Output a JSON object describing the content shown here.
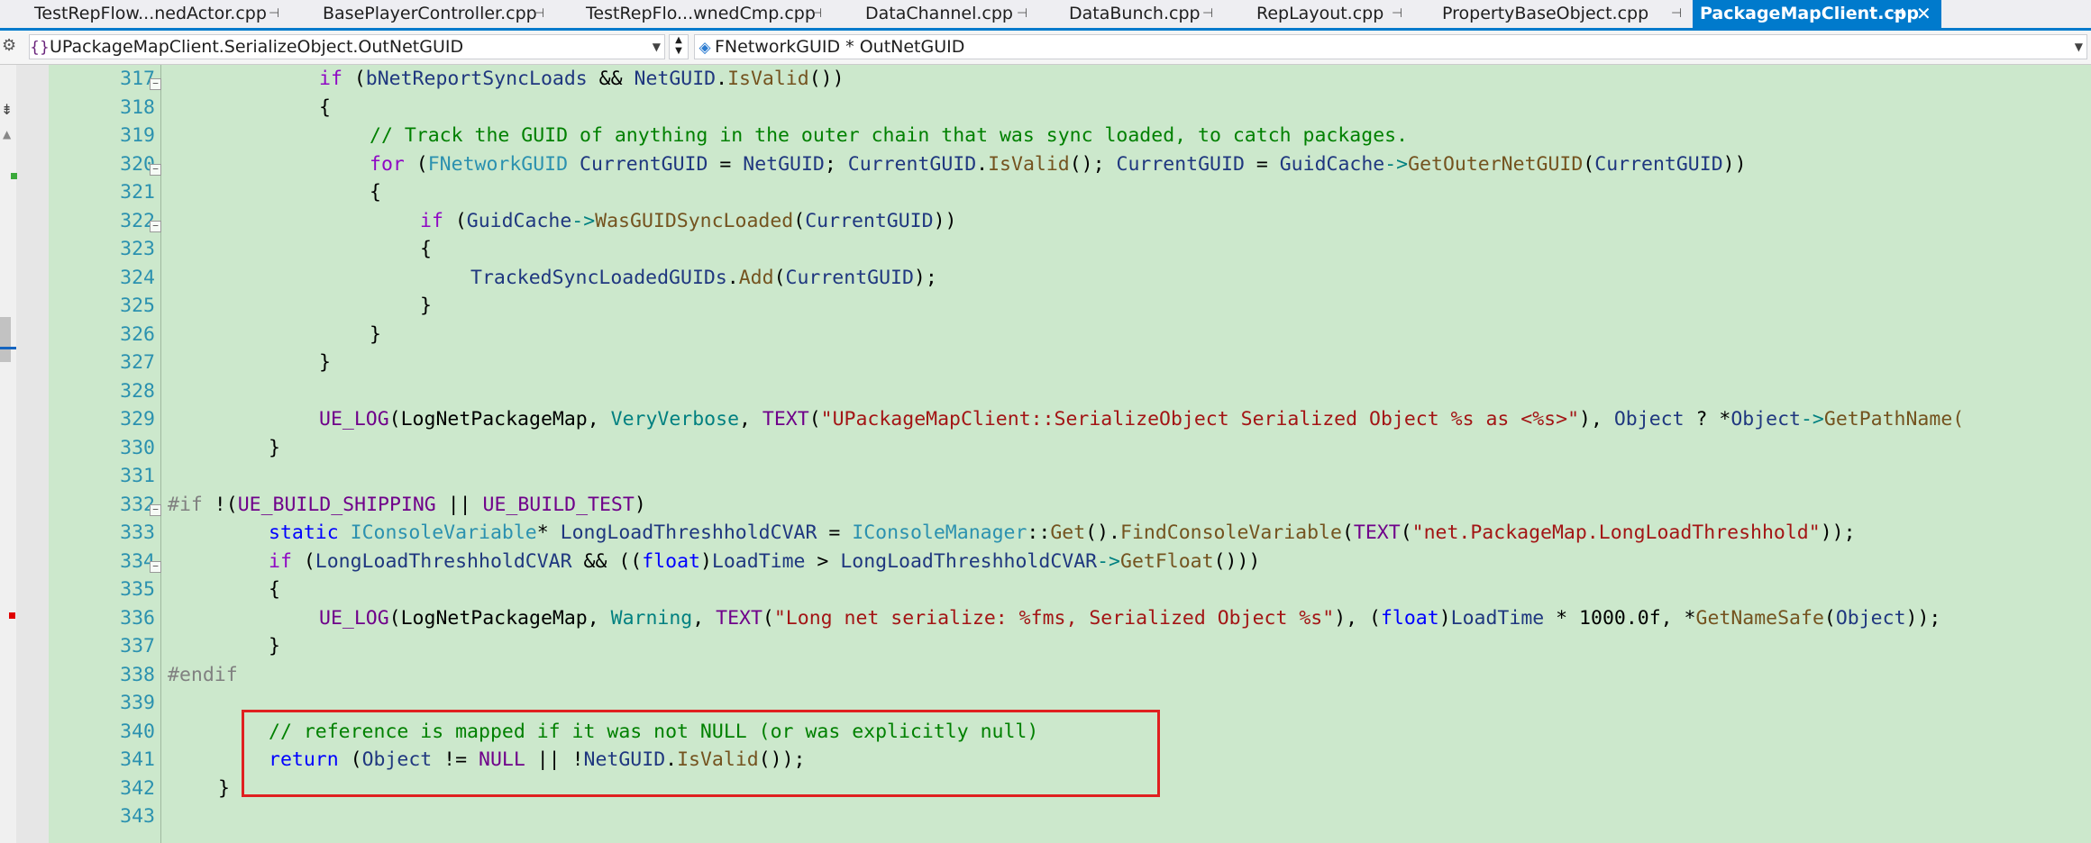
{
  "tabs": [
    {
      "label": "TestRepFlow...nedActor.cpp"
    },
    {
      "label": "BasePlayerController.cpp"
    },
    {
      "label": "TestRepFlo...wnedCmp.cpp"
    },
    {
      "label": "DataChannel.cpp"
    },
    {
      "label": "DataBunch.cpp"
    },
    {
      "label": "RepLayout.cpp"
    },
    {
      "label": "PropertyBaseObject.cpp"
    },
    {
      "label": "PackageMapClient.cpp",
      "active": true
    }
  ],
  "navbar": {
    "scope": "UPackageMapClient.SerializeObject.OutNetGUID",
    "member": "FNetworkGUID * OutNetGUID"
  },
  "code_lines": [
    {
      "n": "317"
    },
    {
      "n": "318"
    },
    {
      "n": "319"
    },
    {
      "n": "320"
    },
    {
      "n": "321"
    },
    {
      "n": "322"
    },
    {
      "n": "323"
    },
    {
      "n": "324"
    },
    {
      "n": "325"
    },
    {
      "n": "326"
    },
    {
      "n": "327"
    },
    {
      "n": "328"
    },
    {
      "n": "329"
    },
    {
      "n": "330"
    },
    {
      "n": "331"
    },
    {
      "n": "332"
    },
    {
      "n": "333"
    },
    {
      "n": "334"
    },
    {
      "n": "335"
    },
    {
      "n": "336"
    },
    {
      "n": "337"
    },
    {
      "n": "338"
    },
    {
      "n": "339"
    },
    {
      "n": "340"
    },
    {
      "n": "341"
    },
    {
      "n": "342"
    },
    {
      "n": "343"
    }
  ],
  "code_text": {
    "l317": [
      "if",
      " (",
      "bNetReportSyncLoads",
      " && ",
      "NetGUID",
      ".",
      "IsValid",
      "())"
    ],
    "l318": [
      "{"
    ],
    "l319": [
      "// Track the GUID of anything in the outer chain that was sync loaded, to catch packages."
    ],
    "l320": [
      "for",
      " (",
      "FNetworkGUID",
      " ",
      "CurrentGUID",
      " = ",
      "NetGUID",
      "; ",
      "CurrentGUID",
      ".",
      "IsValid",
      "(); ",
      "CurrentGUID",
      " = ",
      "GuidCache",
      "->",
      "GetOuterNetGUID",
      "(",
      "CurrentGUID",
      "))"
    ],
    "l321": [
      "{"
    ],
    "l322": [
      "if",
      " (",
      "GuidCache",
      "->",
      "WasGUIDSyncLoaded",
      "(",
      "CurrentGUID",
      "))"
    ],
    "l323": [
      "{"
    ],
    "l324": [
      "TrackedSyncLoadedGUIDs",
      ".",
      "Add",
      "(",
      "CurrentGUID",
      ");"
    ],
    "l325": [
      "}"
    ],
    "l326": [
      "}"
    ],
    "l327": [
      "}"
    ],
    "l328": [
      ""
    ],
    "l329": [
      "UE_LOG",
      "(LogNetPackageMap, ",
      "VeryVerbose",
      ", ",
      "TEXT",
      "(",
      "\"UPackageMapClient::SerializeObject Serialized Object %s as <%s>\"",
      "), ",
      "Object",
      " ? *",
      "Object",
      "->",
      "GetPathName("
    ],
    "l330": [
      "}"
    ],
    "l331": [
      ""
    ],
    "l332": [
      "#if",
      " !(",
      "UE_BUILD_SHIPPING",
      " || ",
      "UE_BUILD_TEST",
      ")"
    ],
    "l333": [
      "static",
      " ",
      "IConsoleVariable",
      "* ",
      "LongLoadThreshholdCVAR",
      " = ",
      "IConsoleManager",
      "::",
      "Get",
      "().",
      "FindConsoleVariable",
      "(",
      "TEXT",
      "(",
      "\"net.PackageMap.LongLoadThreshhold\"",
      "));"
    ],
    "l334": [
      "if",
      " (",
      "LongLoadThreshholdCVAR",
      " && ((",
      "float",
      ")",
      "LoadTime",
      " > ",
      "LongLoadThreshholdCVAR",
      "->",
      "GetFloat",
      "()))"
    ],
    "l335": [
      "{"
    ],
    "l336": [
      "UE_LOG",
      "(LogNetPackageMap, ",
      "Warning",
      ", ",
      "TEXT",
      "(",
      "\"Long net serialize: %fms, Serialized Object %s\"",
      "), (",
      "float",
      ")",
      "LoadTime",
      " * 1000.0f, *",
      "GetNameSafe",
      "(",
      "Object",
      "));"
    ],
    "l337": [
      "}"
    ],
    "l338": [
      "#endif"
    ],
    "l339": [
      ""
    ],
    "l340": [
      "// reference is mapped if it was not NULL (or was explicitly null)"
    ],
    "l341": [
      "return",
      " (",
      "Object",
      " != ",
      "NULL",
      " || !",
      "NetGUID",
      ".",
      "IsValid",
      "());"
    ],
    "l342": [
      "}"
    ],
    "l343": [
      ""
    ]
  },
  "colors": {
    "editor_bg": "#cce8cc",
    "active_tab": "#007acc",
    "line_number": "#2b91af",
    "comment": "#008000",
    "keyword": "#0000ff",
    "control_keyword": "#8f08c4",
    "string": "#a31515",
    "highlight_box": "#e02020"
  },
  "icons": [
    "settings-icon",
    "class-icon",
    "member-icon",
    "pin-icon",
    "close-icon",
    "fold-icon"
  ]
}
